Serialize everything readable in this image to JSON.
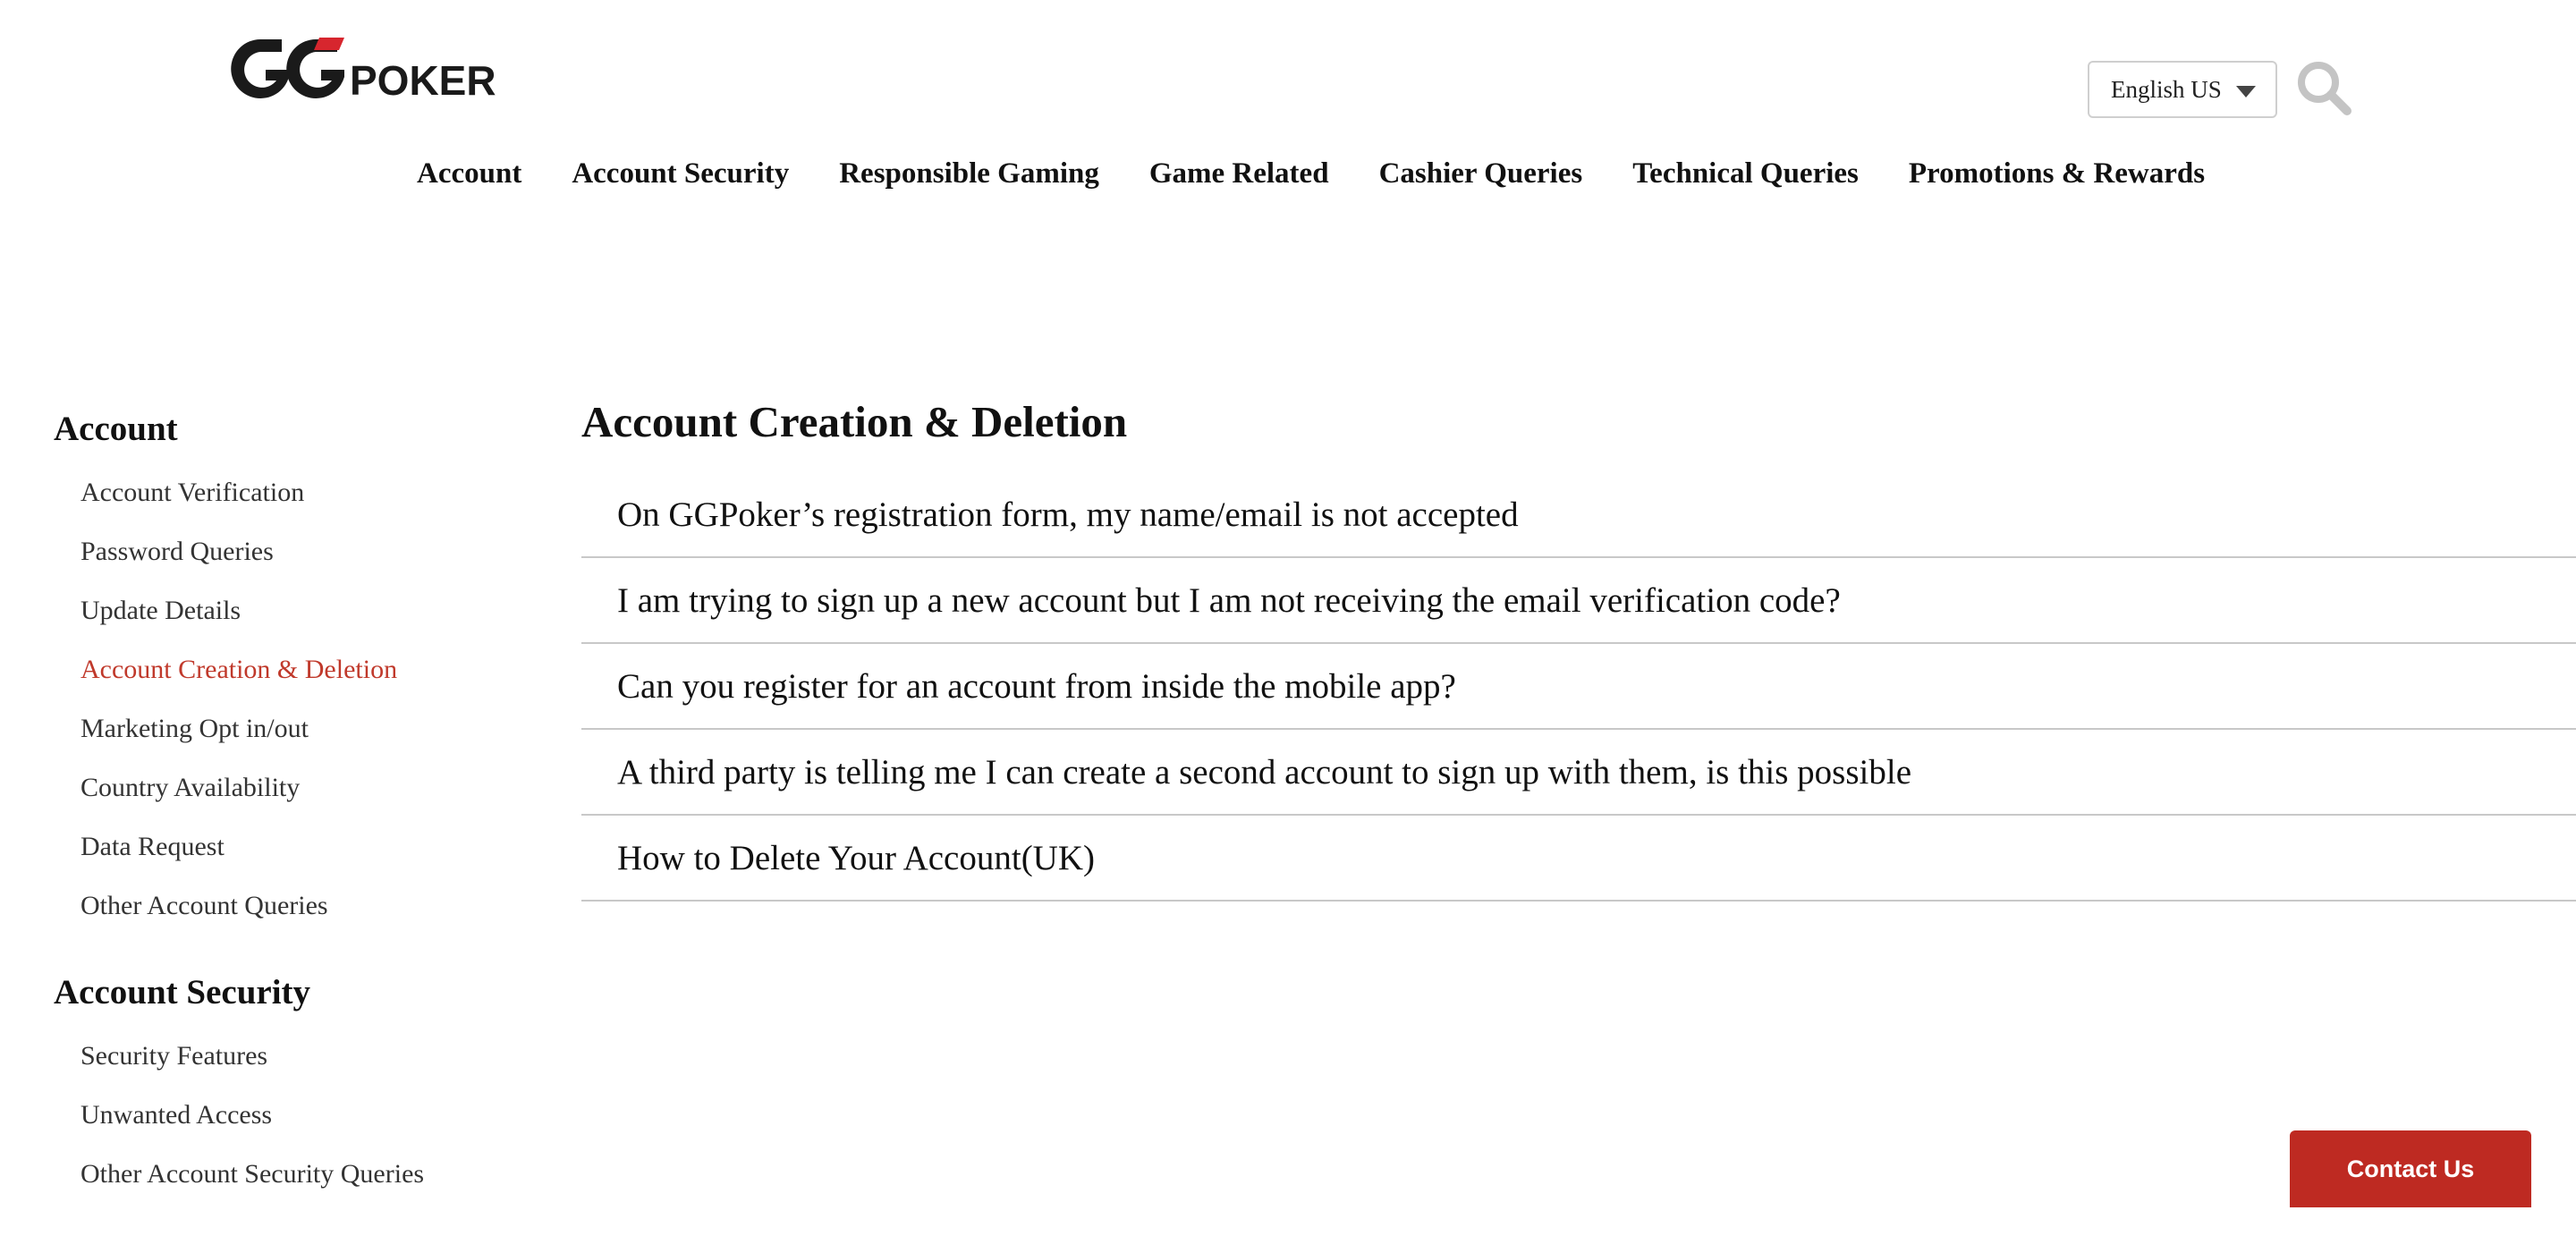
{
  "header": {
    "logo": {
      "text_gg": "GG",
      "text_poker": "POKER",
      "colors": {
        "dark": "#1a1a1a",
        "red": "#d7262e"
      }
    },
    "language": {
      "selected": "English US"
    },
    "search_icon": "search-icon"
  },
  "topnav": {
    "items": [
      "Account",
      "Account Security",
      "Responsible Gaming",
      "Game Related",
      "Cashier Queries",
      "Technical Queries",
      "Promotions & Rewards"
    ]
  },
  "sidebar": {
    "groups": [
      {
        "title": "Account",
        "items": [
          "Account Verification",
          "Password Queries",
          "Update Details",
          "Account Creation & Deletion",
          "Marketing Opt in/out",
          "Country Availability",
          "Data Request",
          "Other Account Queries"
        ],
        "active_index": 3
      },
      {
        "title": "Account Security",
        "items": [
          "Security Features",
          "Unwanted Access",
          "Other Account Security Queries"
        ]
      }
    ],
    "active_color": "#c0392b"
  },
  "main": {
    "title": "Account Creation & Deletion",
    "faqs": [
      "On GGPoker’s registration form, my name/email is not accepted",
      "I am trying to sign up a new account but I am not receiving the email verification code?",
      "Can you register for an account from inside the mobile app?",
      "A third party is telling me I can create a second account to sign up with them, is this possible",
      "How to Delete Your Account(UK)"
    ]
  },
  "contact": {
    "label": "Contact Us",
    "color": "#be2a22"
  }
}
